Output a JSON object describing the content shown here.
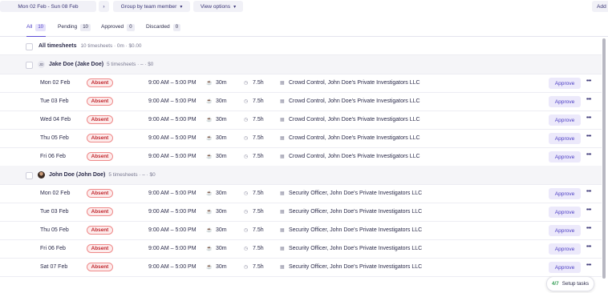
{
  "toolbar": {
    "date_range": "Mon 02 Feb - Sun 08 Feb",
    "group_by": "Group by team member",
    "view_options": "View options",
    "add": "Add"
  },
  "tabs": [
    {
      "label": "All",
      "count": "10"
    },
    {
      "label": "Pending",
      "count": "10"
    },
    {
      "label": "Approved",
      "count": "0"
    },
    {
      "label": "Discarded",
      "count": "0"
    }
  ],
  "summary": {
    "label": "All timesheets",
    "detail": "10 timesheets · 0m · $0.00"
  },
  "groups": [
    {
      "initials": "JD",
      "name": "Jake Doe (Jake Doe)",
      "detail": "5 timesheets · – · $0",
      "rows": [
        {
          "date": "Mon 02 Feb",
          "status": "Absent",
          "time": "9:00 AM – 5:00 PM",
          "break": "30m",
          "hours": "7.5h",
          "position": "Crowd Control, John Doe's Private Investigators LLC",
          "action": "Approve"
        },
        {
          "date": "Tue 03 Feb",
          "status": "Absent",
          "time": "9:00 AM – 5:00 PM",
          "break": "30m",
          "hours": "7.5h",
          "position": "Crowd Control, John Doe's Private Investigators LLC",
          "action": "Approve"
        },
        {
          "date": "Wed 04 Feb",
          "status": "Absent",
          "time": "9:00 AM – 5:00 PM",
          "break": "30m",
          "hours": "7.5h",
          "position": "Crowd Control, John Doe's Private Investigators LLC",
          "action": "Approve"
        },
        {
          "date": "Thu 05 Feb",
          "status": "Absent",
          "time": "9:00 AM – 5:00 PM",
          "break": "30m",
          "hours": "7.5h",
          "position": "Crowd Control, John Doe's Private Investigators LLC",
          "action": "Approve"
        },
        {
          "date": "Fri 06 Feb",
          "status": "Absent",
          "time": "9:00 AM – 5:00 PM",
          "break": "30m",
          "hours": "7.5h",
          "position": "Crowd Control, John Doe's Private Investigators LLC",
          "action": "Approve"
        }
      ]
    },
    {
      "initials": "",
      "name": "John Doe (John Doe)",
      "detail": "5 timesheets · – · $0",
      "rows": [
        {
          "date": "Mon 02 Feb",
          "status": "Absent",
          "time": "9:00 AM – 5:00 PM",
          "break": "30m",
          "hours": "7.5h",
          "position": "Security Officer, John Doe's Private Investigators LLC",
          "action": "Approve"
        },
        {
          "date": "Tue 03 Feb",
          "status": "Absent",
          "time": "9:00 AM – 5:00 PM",
          "break": "30m",
          "hours": "7.5h",
          "position": "Security Officer, John Doe's Private Investigators LLC",
          "action": "Approve"
        },
        {
          "date": "Thu 05 Feb",
          "status": "Absent",
          "time": "9:00 AM – 5:00 PM",
          "break": "30m",
          "hours": "7.5h",
          "position": "Security Officer, John Doe's Private Investigators LLC",
          "action": "Approve"
        },
        {
          "date": "Fri 06 Feb",
          "status": "Absent",
          "time": "9:00 AM – 5:00 PM",
          "break": "30m",
          "hours": "7.5h",
          "position": "Security Officer, John Doe's Private Investigators LLC",
          "action": "Approve"
        },
        {
          "date": "Sat 07 Feb",
          "status": "Absent",
          "time": "9:00 AM – 5:00 PM",
          "break": "30m",
          "hours": "7.5h",
          "position": "Security Officer, John Doe's Private Investigators LLC",
          "action": "Approve"
        }
      ]
    }
  ],
  "setup_tasks": {
    "count": "4/7",
    "label": "Setup tasks"
  },
  "colors": {
    "accent": "#5b4ad6",
    "absent": "#c0282f",
    "approve_bg": "#ece9fb"
  },
  "icons": {
    "break": "coffee-cup-icon",
    "hours": "clock-icon",
    "position": "building-icon",
    "more": "more-dots-icon"
  }
}
